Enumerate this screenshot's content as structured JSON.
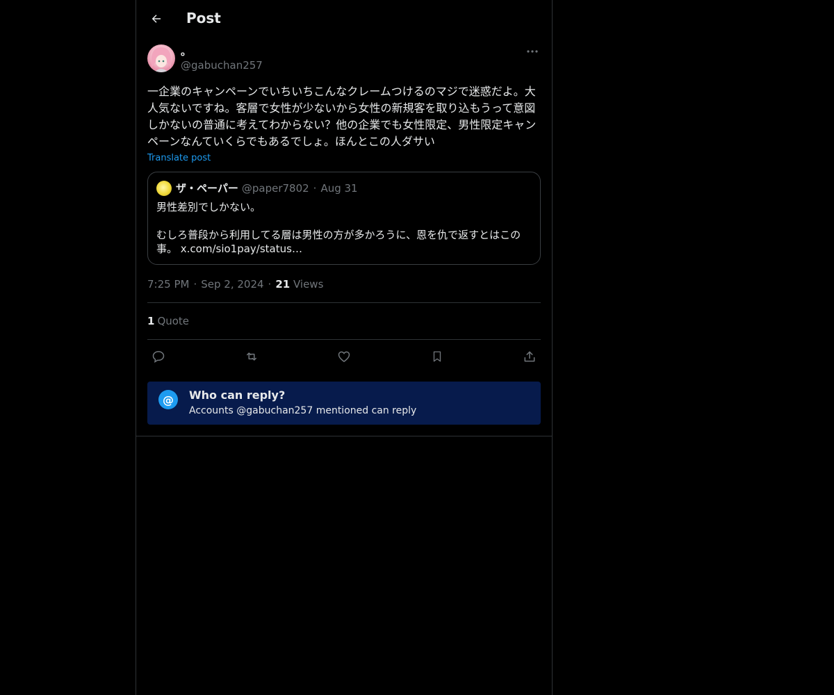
{
  "header": {
    "title": "Post",
    "back_icon": "arrow-left-icon"
  },
  "post": {
    "author": {
      "display_name": "。",
      "handle": "@gabuchan257"
    },
    "text": "一企業のキャンペーンでいちいちこんなクレームつけるのマジで迷惑だよ。大人気ないですね。客層で女性が少ないから女性の新規客を取り込もうって意図しかないの普通に考えてわからない？他の企業でも女性限定、男性限定キャンペーンなんていくらでもあるでしょ。ほんとこの人ダサい",
    "translate_label": "Translate post",
    "quote": {
      "display_name": "ザ・ペーパー",
      "handle": "@paper7802",
      "separator": "·",
      "date": "Aug 31",
      "body": "男性差別でしかない。\n\nむしろ普段から利用してる層は男性の方が多かろうに、恩を仇で返すとはこの事。 x.com/sio1pay/status…"
    },
    "meta": {
      "time": "7:25 PM",
      "date": "Sep 2, 2024",
      "separator": "·",
      "views_count": "21",
      "views_label": "Views"
    },
    "quotes": {
      "count": "1",
      "label": "Quote"
    },
    "actions": [
      "reply-icon",
      "repost-icon",
      "like-icon",
      "bookmark-icon",
      "share-icon"
    ]
  },
  "reply_restriction": {
    "icon_char": "@",
    "title": "Who can reply?",
    "subtitle": "Accounts @gabuchan257 mentioned can reply"
  },
  "colors": {
    "background": "#000000",
    "text": "#e7e9ea",
    "muted": "#71767b",
    "accent": "#1d9bf0",
    "reply_box_bg": "#071b4c",
    "border": "#2f3336"
  }
}
